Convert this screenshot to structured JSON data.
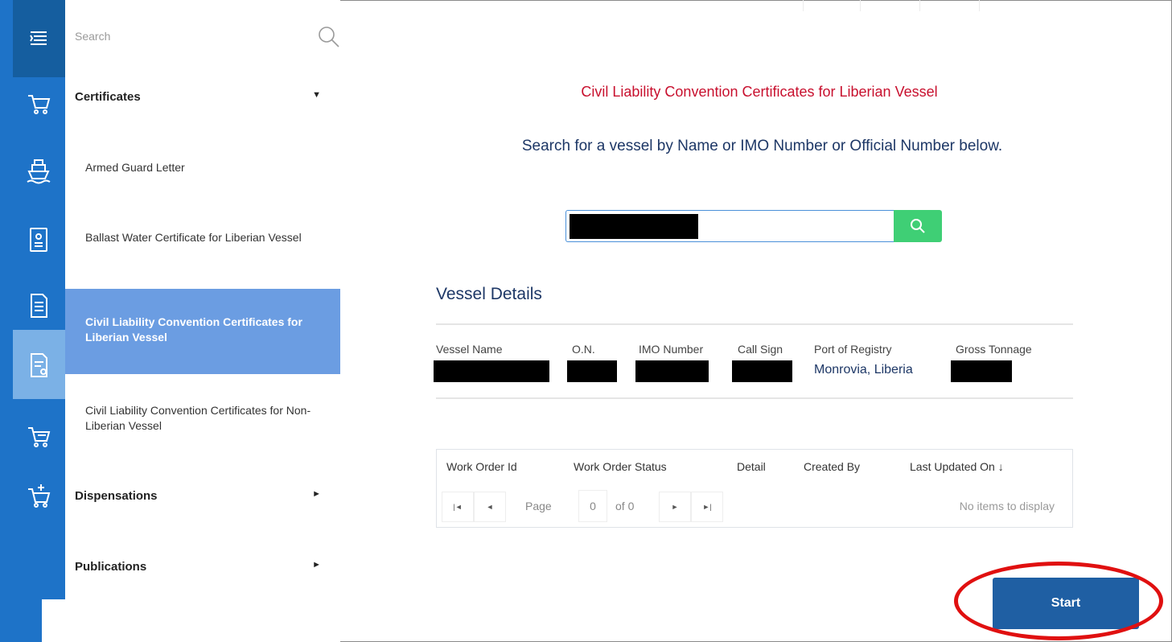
{
  "sidebar": {
    "search_placeholder": "Search",
    "sections": [
      {
        "label": "Certificates",
        "arrow": "▼"
      },
      {
        "label": "Dispensations",
        "arrow": "►"
      },
      {
        "label": "Publications",
        "arrow": "►"
      }
    ],
    "items": [
      {
        "label": "Armed Guard Letter"
      },
      {
        "label": "Ballast Water Certificate for Liberian Vessel"
      },
      {
        "label": "Civil Liability Convention Certificates for Liberian Vessel"
      },
      {
        "label": "Civil Liability Convention Certificates for Non-Liberian Vessel"
      }
    ]
  },
  "main": {
    "title": "Civil Liability Convention Certificates for Liberian Vessel",
    "subtitle": "Search for a vessel by Name or IMO Number or Official Number below.",
    "vessel_details_title": "Vessel Details",
    "vessel_columns": [
      "Vessel Name",
      "O.N.",
      "IMO Number",
      "Call Sign",
      "Port of Registry",
      "Gross Tonnage"
    ],
    "port_of_registry": "Monrovia, Liberia",
    "grid": {
      "headers": [
        "Work Order Id",
        "Work Order Status",
        "Detail",
        "Created By",
        "Last Updated On ↓"
      ],
      "page_label": "Page",
      "page_value": "0",
      "of_label": "of 0",
      "empty_message": "No items to display"
    },
    "start_label": "Start"
  },
  "colors": {
    "rail": "#1e73c8",
    "title_red": "#c8102e",
    "navy": "#1d3766",
    "search_green": "#3fcf75",
    "start_blue": "#1f5fa3",
    "highlight": "#e01010"
  }
}
